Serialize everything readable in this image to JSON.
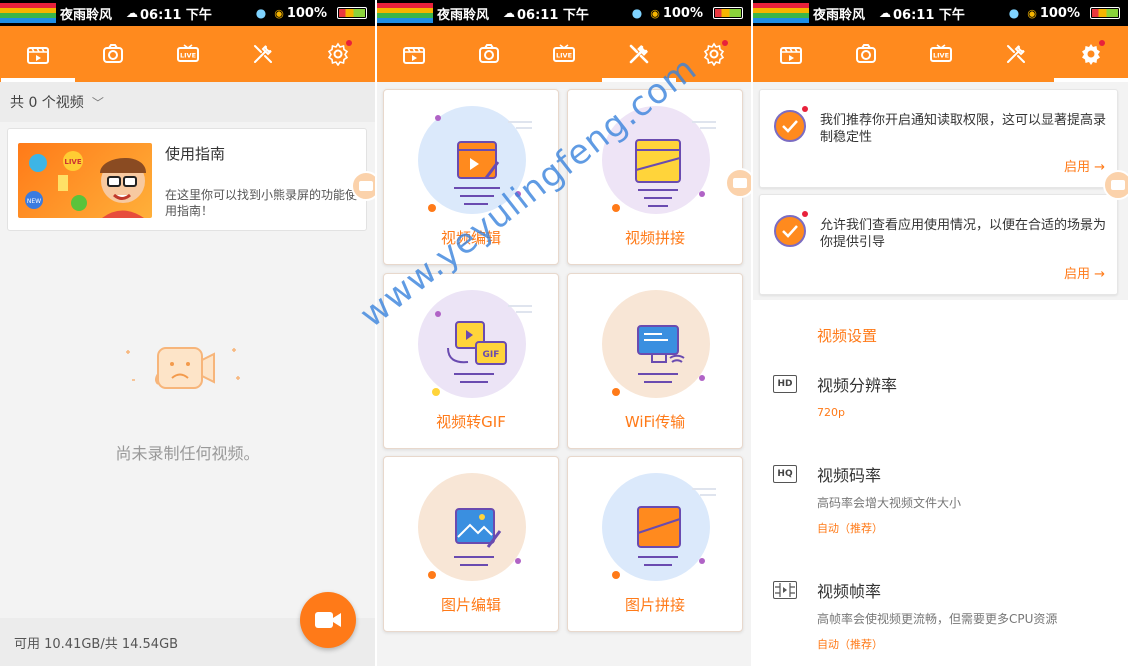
{
  "status": {
    "carrier": "夜雨聆风",
    "time": "06:11 下午",
    "battery": "100%"
  },
  "colors": {
    "accent": "#ff8a1e",
    "bar": "#ff8a1e"
  },
  "tabs": [
    "video-tab",
    "camera-tab",
    "live-tab",
    "tools-tab",
    "settings-tab"
  ],
  "panel1": {
    "count_label": "共 0 个视频",
    "guide": {
      "title": "使用指南",
      "desc": "在这里你可以找到小熊录屏的功能使用指南！"
    },
    "empty_text": "尚未录制任何视频。",
    "storage": "可用 10.41GB/共 14.54GB"
  },
  "panel2": {
    "tools": [
      {
        "label": "视频编辑",
        "icon": "video-edit-icon"
      },
      {
        "label": "视频拼接",
        "icon": "video-merge-icon"
      },
      {
        "label": "视频转GIF",
        "icon": "video-to-gif-icon"
      },
      {
        "label": "WiFi传输",
        "icon": "wifi-transfer-icon"
      },
      {
        "label": "图片编辑",
        "icon": "image-edit-icon"
      },
      {
        "label": "图片拼接",
        "icon": "image-merge-icon"
      }
    ],
    "watermark": "www.yeyulingfeng.com"
  },
  "panel3": {
    "perm1": {
      "text": "我们推荐你开启通知读取权限，这可以显著提高录制稳定性",
      "action": "启用 →"
    },
    "perm2": {
      "text": "允许我们查看应用使用情况，以便在合适的场景为你提供引导",
      "action": "启用 →"
    },
    "section_title": "视频设置",
    "settings": [
      {
        "icon": "HD",
        "title": "视频分辨率",
        "desc": "",
        "value": "720p"
      },
      {
        "icon": "HQ",
        "title": "视频码率",
        "desc": "高码率会增大视频文件大小",
        "value": "自动（推荐）"
      },
      {
        "icon": "",
        "title": "视频帧率",
        "desc": "高帧率会使视频更流畅，但需要更多CPU资源",
        "value": "自动（推荐）"
      }
    ]
  }
}
